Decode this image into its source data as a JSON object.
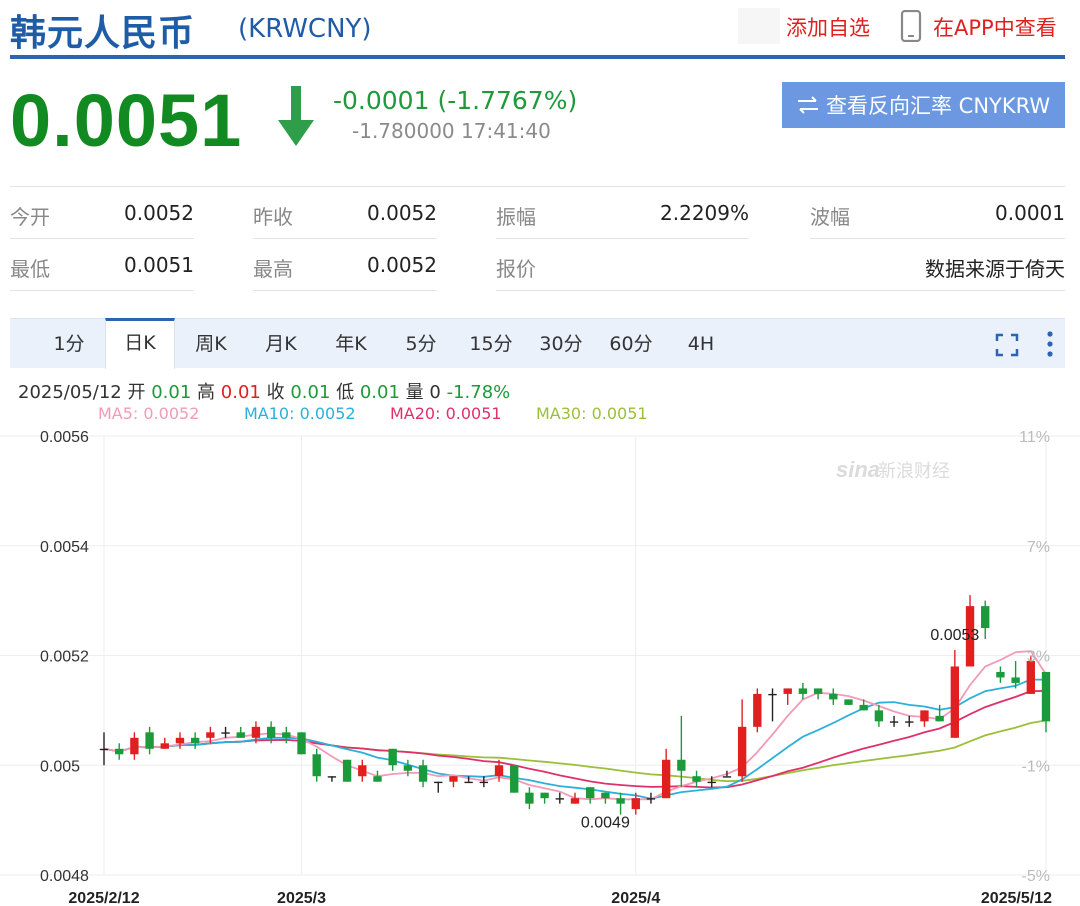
{
  "header": {
    "title": "韩元人民币",
    "code": "(KRWCNY)",
    "add_favorite": "添加自选",
    "view_in_app": "在APP中查看"
  },
  "quote": {
    "price": "0.0051",
    "change": "-0.0001 (-1.7767%)",
    "sub": "-1.780000 17:41:40",
    "reverse_button": "查看反向汇率 CNYKRW",
    "color_down": "#128a22"
  },
  "stats": {
    "open_label": "今开",
    "open": "0.0052",
    "prev_close_label": "昨收",
    "prev_close": "0.0052",
    "amplitude_label": "振幅",
    "amplitude": "2.2209%",
    "wave_label": "波幅",
    "wave": "0.0001",
    "low_label": "最低",
    "low": "0.0051",
    "high_label": "最高",
    "high": "0.0052",
    "quote_label": "报价",
    "source": "数据来源于倚天"
  },
  "tabs": [
    "1分",
    "日K",
    "周K",
    "月K",
    "年K",
    "5分",
    "15分",
    "30分",
    "60分",
    "4H"
  ],
  "active_tab": "日K",
  "icons": {
    "fullscreen": "fullscreen-icon",
    "more": "more-vertical-icon",
    "phone": "phone-icon",
    "swap": "swap-arrows-icon"
  },
  "info": {
    "date": "2025/05/12",
    "open_label": "开",
    "open": "0.01",
    "high_label": "高",
    "high": "0.01",
    "close_label": "收",
    "close": "0.01",
    "low_label": "低",
    "low": "0.01",
    "vol_label": "量",
    "vol": "0",
    "pct": "-1.78%"
  },
  "ma": {
    "ma5": "MA5: 0.0052",
    "ma10": "MA10: 0.0052",
    "ma20": "MA20: 0.0051",
    "ma30": "MA30: 0.0051",
    "colors": {
      "ma5": "#f29ab8",
      "ma10": "#2bb0dc",
      "ma20": "#e0306a",
      "ma30": "#9bbf3a"
    }
  },
  "watermark": {
    "brand": "sina",
    "name": "新浪财经"
  },
  "chart_data": {
    "type": "candlestick",
    "ylim": [
      0.0048,
      0.0056
    ],
    "yticks": [
      "0.0056",
      "0.0054",
      "0.0052",
      "0.005",
      "0.0048"
    ],
    "pct_ticks": [
      "11%",
      "7%",
      "3%",
      "-1%",
      "-5%"
    ],
    "pct_range": [
      -5,
      11
    ],
    "xticks": [
      "2025/2/12",
      "2025/3",
      "2025/4",
      "2025/5/12"
    ],
    "xtick_idx": [
      0,
      13,
      35,
      62
    ],
    "annotations": [
      {
        "text": "0.0053",
        "idx": 56
      },
      {
        "text": "0.0049",
        "idx": 33
      }
    ],
    "up_color": "#e02020",
    "down_color": "#1a9a3a",
    "candles": [
      [
        0.00503,
        0.00503,
        0.005,
        0.00506
      ],
      [
        0.00503,
        0.00502,
        0.00501,
        0.00504
      ],
      [
        0.00502,
        0.00505,
        0.00501,
        0.00506
      ],
      [
        0.00506,
        0.00503,
        0.00502,
        0.00507
      ],
      [
        0.00503,
        0.00504,
        0.00503,
        0.00505
      ],
      [
        0.00504,
        0.00505,
        0.00503,
        0.00506
      ],
      [
        0.00505,
        0.00504,
        0.00503,
        0.00506
      ],
      [
        0.00505,
        0.00506,
        0.00504,
        0.00507
      ],
      [
        0.00506,
        0.00506,
        0.00505,
        0.00507
      ],
      [
        0.00506,
        0.00505,
        0.00505,
        0.00507
      ],
      [
        0.00505,
        0.00507,
        0.00504,
        0.00508
      ],
      [
        0.00507,
        0.00505,
        0.00504,
        0.00508
      ],
      [
        0.00506,
        0.00505,
        0.00504,
        0.00507
      ],
      [
        0.00506,
        0.00502,
        0.00502,
        0.00506
      ],
      [
        0.00502,
        0.00498,
        0.00497,
        0.00503
      ],
      [
        0.00498,
        0.00498,
        0.00497,
        0.00498
      ],
      [
        0.00501,
        0.00497,
        0.00497,
        0.00501
      ],
      [
        0.00498,
        0.005,
        0.00497,
        0.00501
      ],
      [
        0.00498,
        0.00497,
        0.00497,
        0.00499
      ],
      [
        0.00503,
        0.005,
        0.00499,
        0.00503
      ],
      [
        0.005,
        0.00499,
        0.00498,
        0.00501
      ],
      [
        0.005,
        0.00497,
        0.00496,
        0.00501
      ],
      [
        0.00497,
        0.00497,
        0.00495,
        0.00497
      ],
      [
        0.00497,
        0.00498,
        0.00496,
        0.00498
      ],
      [
        0.00497,
        0.00497,
        0.00497,
        0.00498
      ],
      [
        0.00497,
        0.00497,
        0.00496,
        0.00498
      ],
      [
        0.00498,
        0.005,
        0.00497,
        0.00501
      ],
      [
        0.005,
        0.00495,
        0.00495,
        0.005
      ],
      [
        0.00495,
        0.00493,
        0.00492,
        0.00496
      ],
      [
        0.00495,
        0.00494,
        0.00493,
        0.00495
      ],
      [
        0.00494,
        0.00494,
        0.00493,
        0.00495
      ],
      [
        0.00493,
        0.00494,
        0.00493,
        0.00495
      ],
      [
        0.00496,
        0.00494,
        0.00493,
        0.00496
      ],
      [
        0.00495,
        0.00494,
        0.00493,
        0.00495
      ],
      [
        0.00494,
        0.00493,
        0.00491,
        0.00495
      ],
      [
        0.00492,
        0.00494,
        0.00491,
        0.00495
      ],
      [
        0.00494,
        0.00494,
        0.00493,
        0.00495
      ],
      [
        0.00494,
        0.00501,
        0.00494,
        0.00503
      ],
      [
        0.00501,
        0.00499,
        0.00496,
        0.00509
      ],
      [
        0.00498,
        0.00497,
        0.00496,
        0.00499
      ],
      [
        0.00497,
        0.00497,
        0.00496,
        0.00498
      ],
      [
        0.00498,
        0.00498,
        0.00498,
        0.00499
      ]
    ]
  }
}
